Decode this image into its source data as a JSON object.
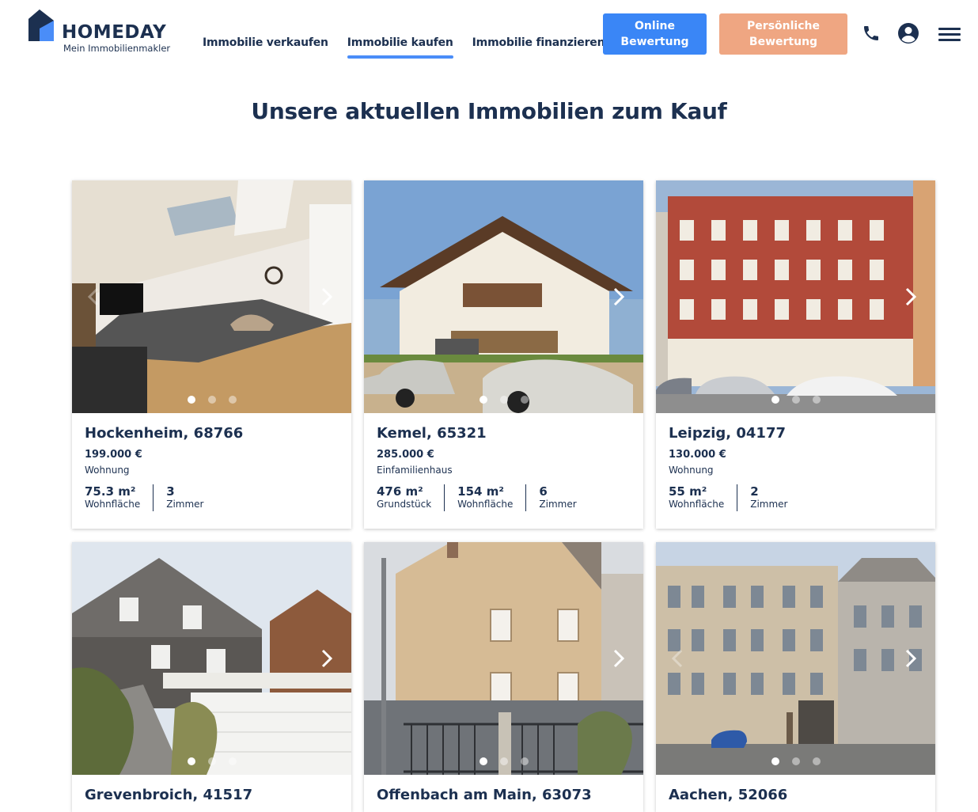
{
  "brand": {
    "name": "HOMEDAY",
    "tagline": "Mein Immobilienmakler"
  },
  "nav": [
    {
      "label": "Immobilie verkaufen",
      "active": false
    },
    {
      "label": "Immobilie kaufen",
      "active": true
    },
    {
      "label": "Immobilie finanzieren",
      "active": false
    }
  ],
  "buttons": {
    "online_valuation": [
      "Online",
      "Bewertung"
    ],
    "personal_valuation": [
      "Persönliche",
      "Bewertung"
    ]
  },
  "icons": {
    "phone": "phone-icon",
    "account": "account-icon",
    "menu": "hamburger-menu-icon"
  },
  "colors": {
    "navy": "#1c3050",
    "blue": "#3a86f6",
    "peach": "#efa682",
    "underline": "#4a8df8"
  },
  "page_title": "Unsere aktuellen Immobilien zum Kauf",
  "listings": [
    {
      "city": "Hockenheim, 68766",
      "price": "199.000 €",
      "type": "Wohnung",
      "facts": [
        {
          "value": "75.3 m²",
          "label": "Wohnfläche"
        },
        {
          "value": "3",
          "label": "Zimmer"
        }
      ]
    },
    {
      "city": "Kemel, 65321",
      "price": "285.000 €",
      "type": "Einfamilienhaus",
      "facts": [
        {
          "value": "476 m²",
          "label": "Grundstück"
        },
        {
          "value": "154 m²",
          "label": "Wohnfläche"
        },
        {
          "value": "6",
          "label": "Zimmer"
        }
      ]
    },
    {
      "city": "Leipzig, 04177",
      "price": "130.000 €",
      "type": "Wohnung",
      "facts": [
        {
          "value": "55 m²",
          "label": "Wohnfläche"
        },
        {
          "value": "2",
          "label": "Zimmer"
        }
      ]
    },
    {
      "city": "Grevenbroich, 41517"
    },
    {
      "city": "Offenbach am Main, 63073"
    },
    {
      "city": "Aachen, 52066"
    }
  ]
}
